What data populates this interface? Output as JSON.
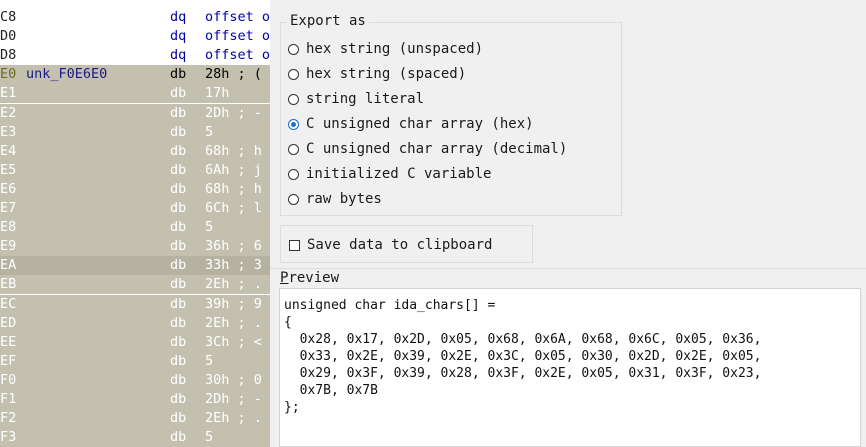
{
  "disasm": {
    "lines": [
      {
        "addr": "C8",
        "label": "",
        "mnemonic": "dq",
        "operand": "offset o",
        "kind": "code"
      },
      {
        "addr": "D0",
        "label": "",
        "mnemonic": "dq",
        "operand": "offset o",
        "kind": "code"
      },
      {
        "addr": "D8",
        "label": "",
        "mnemonic": "dq",
        "operand": "offset o",
        "kind": "code"
      },
      {
        "addr": "E0",
        "label": "unk_F0E6E0",
        "mnemonic": "db",
        "operand": "28h ; (",
        "kind": "sel"
      },
      {
        "addr": "E1",
        "label": "",
        "mnemonic": "db",
        "operand": "17h",
        "kind": "data"
      },
      {
        "addr": "E2",
        "label": "",
        "mnemonic": "db",
        "operand": "2Dh ; -",
        "kind": "data"
      },
      {
        "addr": "E3",
        "label": "",
        "mnemonic": "db",
        "operand": "5",
        "kind": "data"
      },
      {
        "addr": "E4",
        "label": "",
        "mnemonic": "db",
        "operand": "68h ; h",
        "kind": "data"
      },
      {
        "addr": "E5",
        "label": "",
        "mnemonic": "db",
        "operand": "6Ah ; j",
        "kind": "data"
      },
      {
        "addr": "E6",
        "label": "",
        "mnemonic": "db",
        "operand": "68h ; h",
        "kind": "data"
      },
      {
        "addr": "E7",
        "label": "",
        "mnemonic": "db",
        "operand": "6Ch ; l",
        "kind": "data"
      },
      {
        "addr": "E8",
        "label": "",
        "mnemonic": "db",
        "operand": "5",
        "kind": "data"
      },
      {
        "addr": "E9",
        "label": "",
        "mnemonic": "db",
        "operand": "36h ; 6",
        "kind": "data"
      },
      {
        "addr": "EA",
        "label": "",
        "mnemonic": "db",
        "operand": "33h ; 3",
        "kind": "data hl"
      },
      {
        "addr": "EB",
        "label": "",
        "mnemonic": "db",
        "operand": "2Eh ; .",
        "kind": "data"
      },
      {
        "addr": "EC",
        "label": "",
        "mnemonic": "db",
        "operand": "39h ; 9",
        "kind": "data"
      },
      {
        "addr": "ED",
        "label": "",
        "mnemonic": "db",
        "operand": "2Eh ; .",
        "kind": "data"
      },
      {
        "addr": "EE",
        "label": "",
        "mnemonic": "db",
        "operand": "3Ch ; <",
        "kind": "data"
      },
      {
        "addr": "EF",
        "label": "",
        "mnemonic": "db",
        "operand": "5",
        "kind": "data"
      },
      {
        "addr": "F0",
        "label": "",
        "mnemonic": "db",
        "operand": "30h ; 0",
        "kind": "data"
      },
      {
        "addr": "F1",
        "label": "",
        "mnemonic": "db",
        "operand": "2Dh ; -",
        "kind": "data"
      },
      {
        "addr": "F2",
        "label": "",
        "mnemonic": "db",
        "operand": "2Eh ; .",
        "kind": "data"
      },
      {
        "addr": "F3",
        "label": "",
        "mnemonic": "db",
        "operand": "5",
        "kind": "data"
      }
    ]
  },
  "dialog": {
    "export_group_title": "Export as",
    "options": [
      {
        "label": "hex string (unspaced)",
        "selected": false
      },
      {
        "label": "hex string (spaced)",
        "selected": false
      },
      {
        "label": "string literal",
        "selected": false
      },
      {
        "label": "C unsigned char array (hex)",
        "selected": true
      },
      {
        "label": "C unsigned char array (decimal)",
        "selected": false
      },
      {
        "label": "initialized C variable",
        "selected": false
      },
      {
        "label": "raw bytes",
        "selected": false
      }
    ],
    "save_checkbox_label": "Save data to clipboard",
    "save_checked": false,
    "preview_label_prefix": "P",
    "preview_label_rest": "review",
    "preview_text": "unsigned char ida_chars[] =\n{\n  0x28, 0x17, 0x2D, 0x05, 0x68, 0x6A, 0x68, 0x6C, 0x05, 0x36,\n  0x33, 0x2E, 0x39, 0x2E, 0x3C, 0x05, 0x30, 0x2D, 0x2E, 0x05,\n  0x29, 0x3F, 0x39, 0x28, 0x3F, 0x2E, 0x05, 0x31, 0x3F, 0x23,\n  0x7B, 0x7B\n};",
    "accent_color": "#1a6fd1"
  }
}
